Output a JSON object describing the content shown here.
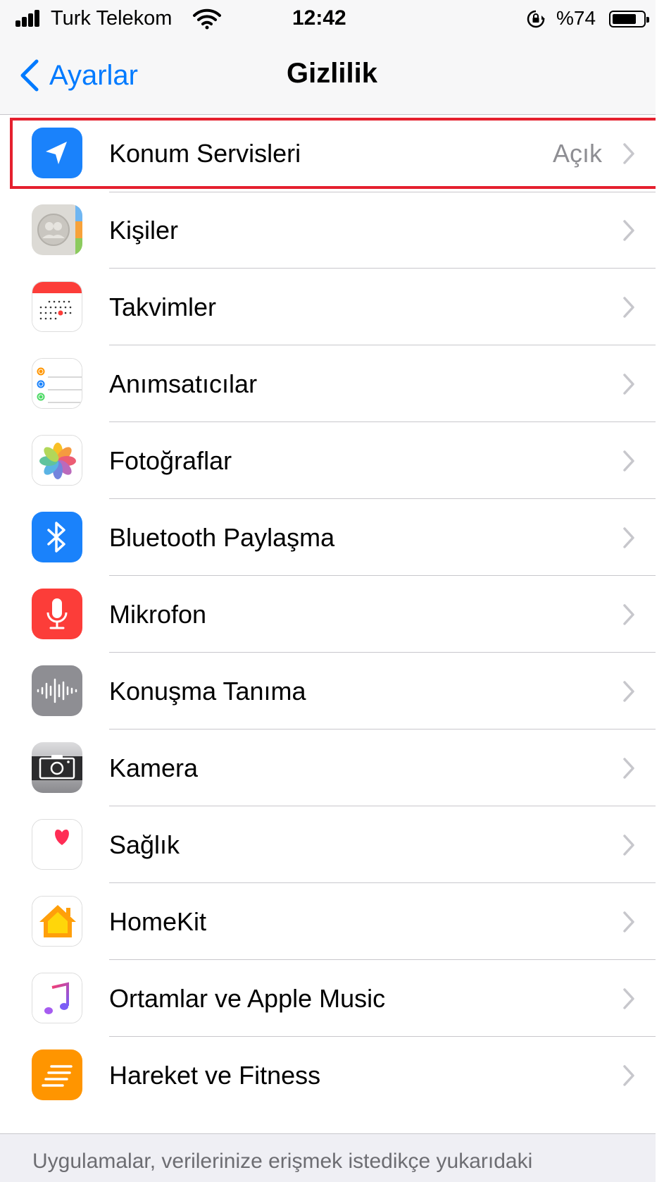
{
  "status_bar": {
    "carrier": "Turk Telekom",
    "time": "12:42",
    "battery_text": "%74",
    "battery_level": 0.74
  },
  "nav": {
    "back_label": "Ayarlar",
    "title": "Gizlilik"
  },
  "rows": [
    {
      "label": "Konum Servisleri",
      "value": "Açık",
      "icon": "location-arrow-icon",
      "color": "#1a82fb"
    },
    {
      "label": "Kişiler",
      "icon": "contacts-icon"
    },
    {
      "label": "Takvimler",
      "icon": "calendar-icon"
    },
    {
      "label": "Anımsatıcılar",
      "icon": "reminders-icon"
    },
    {
      "label": "Fotoğraflar",
      "icon": "photos-icon"
    },
    {
      "label": "Bluetooth Paylaşma",
      "icon": "bluetooth-icon",
      "color": "#1a82fb"
    },
    {
      "label": "Mikrofon",
      "icon": "microphone-icon",
      "color": "#fc3d39"
    },
    {
      "label": "Konuşma Tanıma",
      "icon": "speech-waveform-icon",
      "color": "#8e8e93"
    },
    {
      "label": "Kamera",
      "icon": "camera-icon"
    },
    {
      "label": "Sağlık",
      "icon": "health-heart-icon"
    },
    {
      "label": "HomeKit",
      "icon": "homekit-house-icon"
    },
    {
      "label": "Ortamlar ve Apple Music",
      "icon": "music-note-icon"
    },
    {
      "label": "Hareket ve Fitness",
      "icon": "motion-fitness-icon",
      "color": "#ff9500"
    }
  ],
  "footer": {
    "text": "Uygulamalar, verilerinize erişmek istedikçe yukarıdaki kategorilere eklenir."
  },
  "colors": {
    "accent": "#007aff",
    "highlight_border": "#e5202e"
  }
}
